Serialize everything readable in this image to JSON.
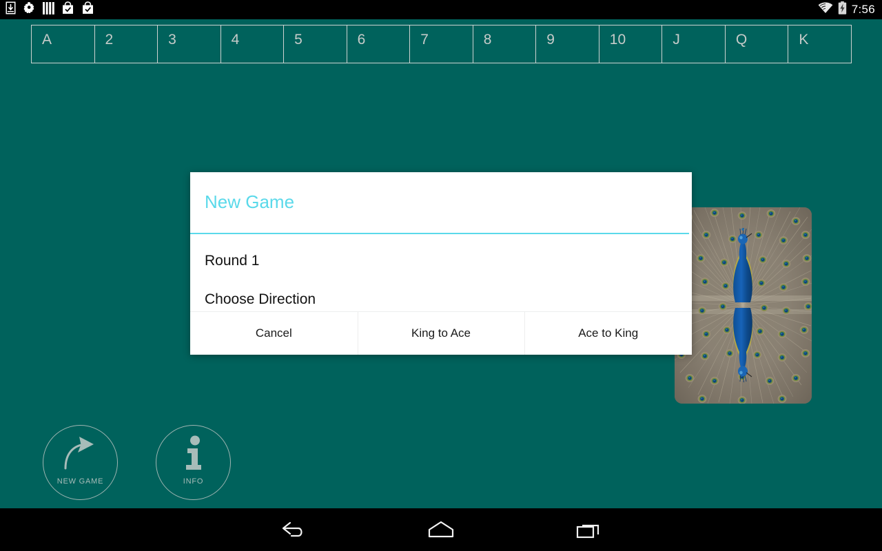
{
  "status_bar": {
    "icons": [
      "download-icon",
      "app-sprite-icon",
      "bars-icon",
      "shopping-bag-check-icon",
      "shopping-bag-check-icon"
    ],
    "wifi_icon": "wifi-icon",
    "battery_icon": "battery-charging-icon",
    "clock": "7:56"
  },
  "board": {
    "rank_slots": [
      "A",
      "2",
      "3",
      "4",
      "5",
      "6",
      "7",
      "8",
      "9",
      "10",
      "J",
      "Q",
      "K"
    ]
  },
  "card": {
    "name": "peacock-card",
    "alt": "Peacock card back"
  },
  "actions": [
    {
      "id": "new-game",
      "caption": "NEW GAME",
      "icon": "curved-arrow-icon"
    },
    {
      "id": "info",
      "caption": "INFO",
      "icon": "info-icon"
    }
  ],
  "dialog": {
    "title": "New Game",
    "line1": "Round 1",
    "line2": "Choose Direction",
    "buttons": [
      {
        "id": "cancel",
        "label": "Cancel"
      },
      {
        "id": "king-to-ace",
        "label": "King to Ace"
      },
      {
        "id": "ace-to-king",
        "label": "Ace to King"
      }
    ]
  },
  "navigation": {
    "back": "back-icon",
    "home": "home-icon",
    "recents": "recents-icon"
  },
  "colors": {
    "background": "#00625c",
    "accent": "#5ad9ea",
    "slot_border": "#cfd3d1",
    "slot_text": "#c6cbc9",
    "dialog_bg": "#ffffff",
    "statusbar_bg": "#000000"
  }
}
